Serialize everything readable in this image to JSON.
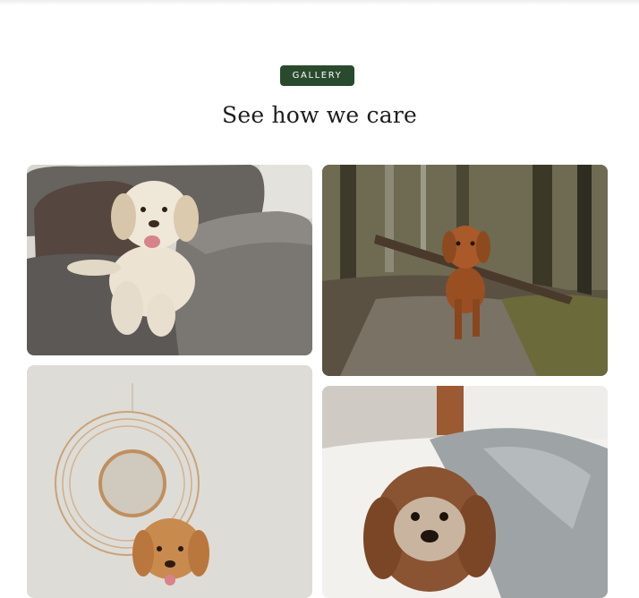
{
  "section": {
    "badge": "GALLERY",
    "heading": "See how we care"
  },
  "gallery": {
    "photos": [
      {
        "subject": "cream doodle on grey sofa"
      },
      {
        "subject": "brown dog carrying stick in forest"
      },
      {
        "subject": "apricot doodle in front of round wall mirror"
      },
      {
        "subject": "chocolate cavapoo on bed with grey blanket"
      }
    ]
  }
}
